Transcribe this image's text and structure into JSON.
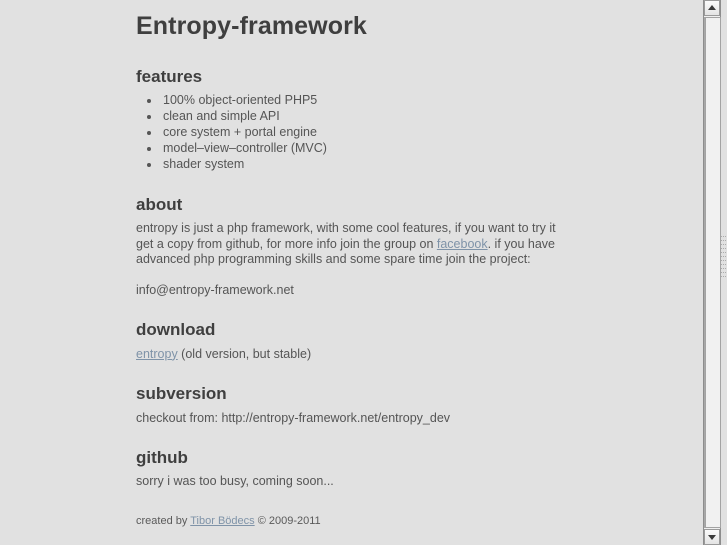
{
  "page": {
    "title": "Entropy-framework",
    "background_color": "#e1e1e1",
    "text_color": "#555555",
    "heading_color": "#3f3f3f",
    "link_color": "#7f93a8"
  },
  "sections": {
    "features": {
      "heading": "features",
      "items": [
        "100% object-oriented PHP5",
        "clean and simple API",
        "core system + portal engine",
        "model–view–controller (MVC)",
        "shader system"
      ]
    },
    "about": {
      "heading": "about",
      "paragraph_part1": "entropy is just a php framework, with some cool features, if you want to try it get a copy from github, for more info join the group on ",
      "link_label": "facebook",
      "paragraph_part2": ". if you have advanced php programming skills and some spare time join the project:",
      "email": "info@entropy-framework.net"
    },
    "download": {
      "heading": "download",
      "link_label": "entropy",
      "note": " (old version, but stable)"
    },
    "subversion": {
      "heading": "subversion",
      "text": "checkout from: http://entropy-framework.net/entropy_dev"
    },
    "github": {
      "heading": "github",
      "text": "sorry i was too busy, coming soon..."
    }
  },
  "footer": {
    "prefix": "created by ",
    "author_link": "Tibor Bödecs",
    "suffix": " © 2009-2011"
  },
  "scrollbar": {
    "up_icon": "triangle-up-icon",
    "down_icon": "triangle-down-icon"
  }
}
